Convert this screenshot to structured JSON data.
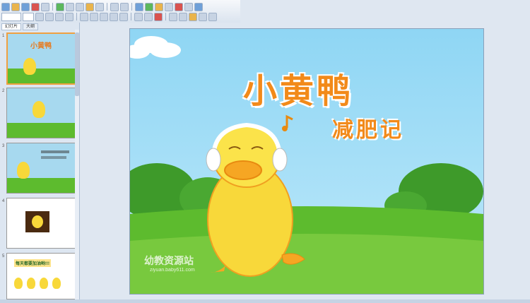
{
  "panel": {
    "tabs": [
      {
        "label": "幻灯片"
      },
      {
        "label": "大纲"
      }
    ],
    "thumbnails": [
      {
        "number": "1",
        "title": "小黄鸭"
      },
      {
        "number": "2"
      },
      {
        "number": "3"
      },
      {
        "number": "4"
      },
      {
        "number": "5",
        "banner": "每天都要加油哟!!!"
      }
    ]
  },
  "slide": {
    "title": "小黄鸭",
    "subtitle": "减肥记",
    "watermark_cn": "幼教资源站",
    "watermark_url": "ziyuan.baby611.com"
  },
  "colors": {
    "sky": "#8fd6f4",
    "grass": "#5dbb2e",
    "duck": "#f8d83a",
    "title_orange": "#f28a1a",
    "active_thumb_border": "#f0a040"
  }
}
